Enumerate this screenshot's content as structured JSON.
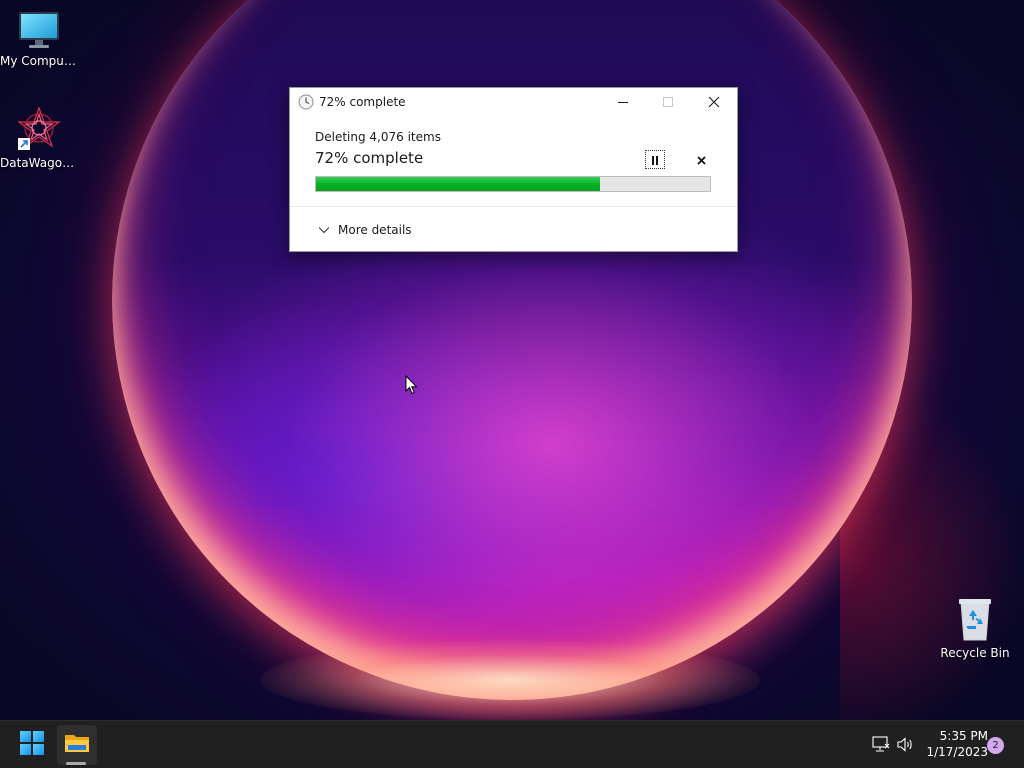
{
  "desktop": {
    "icons": [
      {
        "label": "My Computer",
        "icon": "monitor-icon"
      },
      {
        "label": "DataWagon...",
        "icon": "datawagon-app-icon",
        "shortcut": true
      },
      {
        "label": "Recycle Bin",
        "icon": "recycle-bin-icon"
      }
    ]
  },
  "dialog": {
    "title": "72% complete",
    "title_icon": "clock-icon",
    "heading": "Deleting 4,076 items",
    "percent_text": "72% complete",
    "progress": 0.72,
    "more_details_label": "More details",
    "buttons": {
      "minimize": "minimize-icon",
      "maximize": "maximize-icon",
      "close": "close-icon",
      "pause": "pause-icon",
      "cancel": "cancel-icon"
    }
  },
  "taskbar": {
    "start_icon": "windows-logo-icon",
    "pinned": [
      {
        "name": "File Explorer",
        "icon": "folder-icon",
        "active": true
      }
    ],
    "tray": {
      "network_icon": "network-icon",
      "volume_icon": "volume-icon"
    },
    "clock": {
      "time": "5:35 PM",
      "date": "1/17/2023"
    },
    "notification_count": "2"
  },
  "colors": {
    "progress_fill": "#06b025",
    "taskbar": "#202020",
    "notification_badge": "#d3a8ef"
  }
}
